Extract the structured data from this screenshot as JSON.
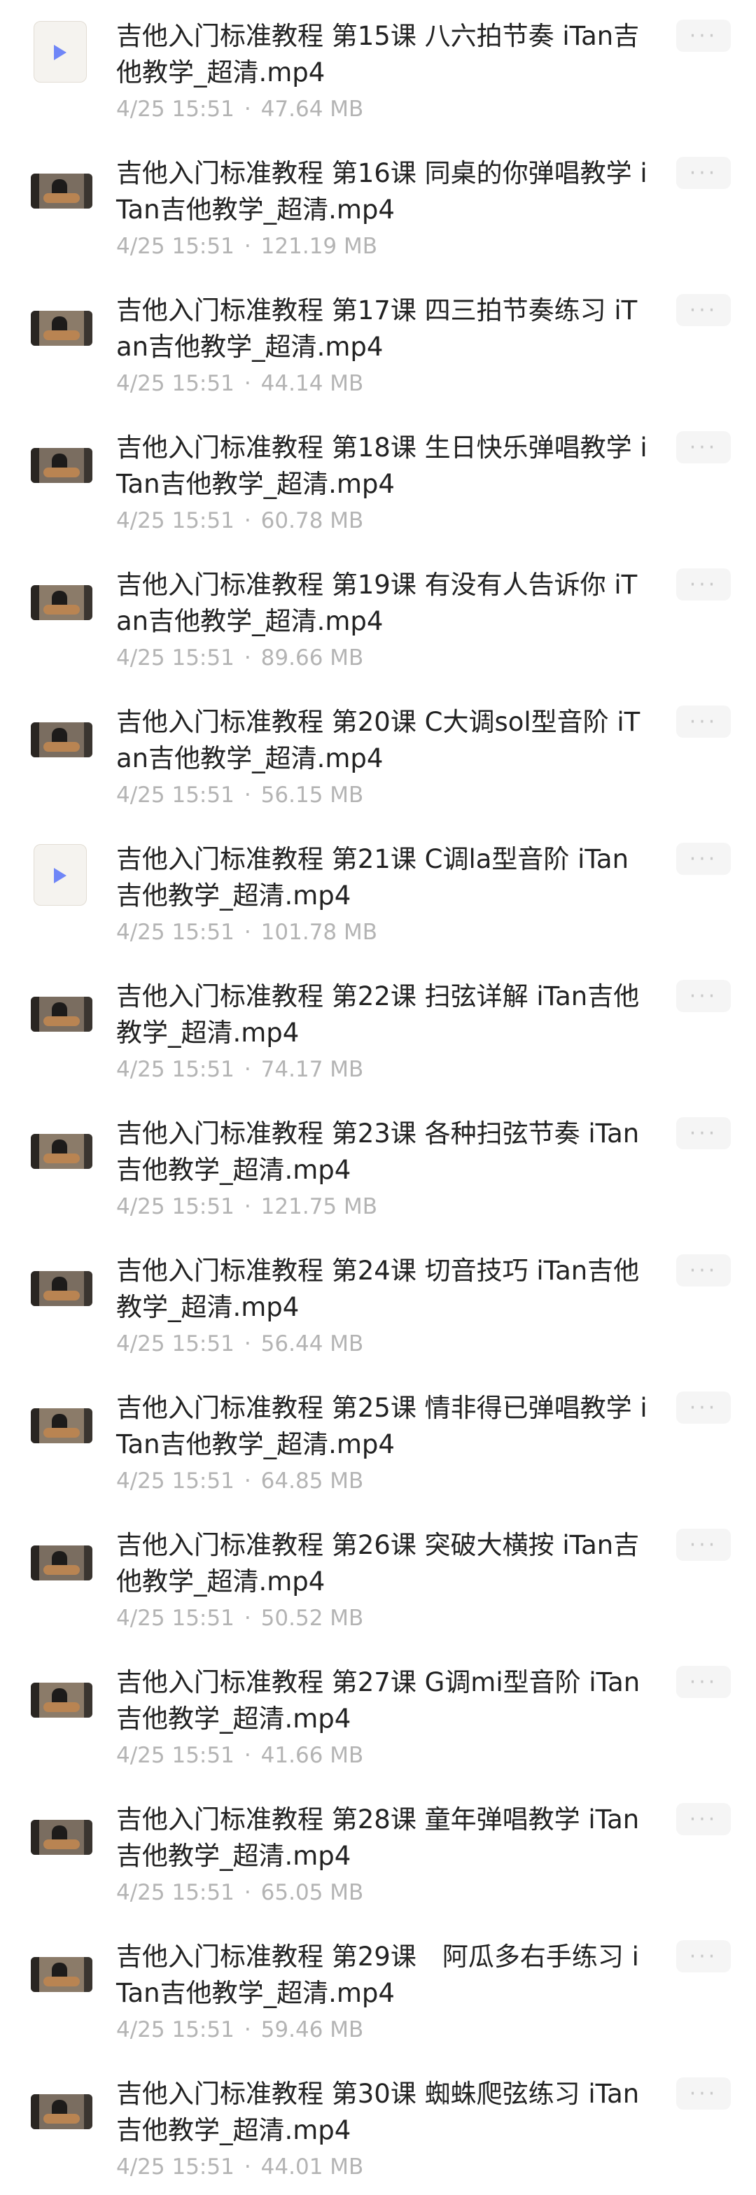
{
  "files": [
    {
      "title": "吉他入门标准教程 第15课 八六拍节奏 iTan吉他教学_超清.mp4",
      "time": "4/25 15:51",
      "size": "47.64 MB",
      "thumb": "file-icon"
    },
    {
      "title": "吉他入门标准教程 第16课 同桌的你弹唱教学 iTan吉他教学_超清.mp4",
      "time": "4/25 15:51",
      "size": "121.19 MB",
      "thumb": "video"
    },
    {
      "title": "吉他入门标准教程 第17课 四三拍节奏练习 iTan吉他教学_超清.mp4",
      "time": "4/25 15:51",
      "size": "44.14 MB",
      "thumb": "video"
    },
    {
      "title": "吉他入门标准教程 第18课 生日快乐弹唱教学 iTan吉他教学_超清.mp4",
      "time": "4/25 15:51",
      "size": "60.78 MB",
      "thumb": "video"
    },
    {
      "title": "吉他入门标准教程 第19课 有没有人告诉你 iTan吉他教学_超清.mp4",
      "time": "4/25 15:51",
      "size": "89.66 MB",
      "thumb": "video"
    },
    {
      "title": "吉他入门标准教程 第20课 C大调sol型音阶 iTan吉他教学_超清.mp4",
      "time": "4/25 15:51",
      "size": "56.15 MB",
      "thumb": "video"
    },
    {
      "title": "吉他入门标准教程 第21课 C调la型音阶 iTan吉他教学_超清.mp4",
      "time": "4/25 15:51",
      "size": "101.78 MB",
      "thumb": "file-icon"
    },
    {
      "title": "吉他入门标准教程 第22课 扫弦详解 iTan吉他教学_超清.mp4",
      "time": "4/25 15:51",
      "size": "74.17 MB",
      "thumb": "video"
    },
    {
      "title": "吉他入门标准教程 第23课 各种扫弦节奏 iTan吉他教学_超清.mp4",
      "time": "4/25 15:51",
      "size": "121.75 MB",
      "thumb": "video"
    },
    {
      "title": "吉他入门标准教程 第24课 切音技巧 iTan吉他教学_超清.mp4",
      "time": "4/25 15:51",
      "size": "56.44 MB",
      "thumb": "video"
    },
    {
      "title": "吉他入门标准教程 第25课 情非得已弹唱教学 iTan吉他教学_超清.mp4",
      "time": "4/25 15:51",
      "size": "64.85 MB",
      "thumb": "video"
    },
    {
      "title": "吉他入门标准教程 第26课 突破大横按 iTan吉他教学_超清.mp4",
      "time": "4/25 15:51",
      "size": "50.52 MB",
      "thumb": "video"
    },
    {
      "title": "吉他入门标准教程 第27课 G调mi型音阶 iTan吉他教学_超清.mp4",
      "time": "4/25 15:51",
      "size": "41.66 MB",
      "thumb": "video"
    },
    {
      "title": "吉他入门标准教程 第28课 童年弹唱教学 iTan吉他教学_超清.mp4",
      "time": "4/25 15:51",
      "size": "65.05 MB",
      "thumb": "video"
    },
    {
      "title": "吉他入门标准教程 第29课　阿瓜多右手练习 iTan吉他教学_超清.mp4",
      "time": "4/25 15:51",
      "size": "59.46 MB",
      "thumb": "video"
    },
    {
      "title": "吉他入门标准教程 第30课 蜘蛛爬弦练习 iTan吉他教学_超清.mp4",
      "time": "4/25 15:51",
      "size": "44.01 MB",
      "thumb": "video"
    }
  ],
  "meta_separator": "·",
  "more_label": "···"
}
